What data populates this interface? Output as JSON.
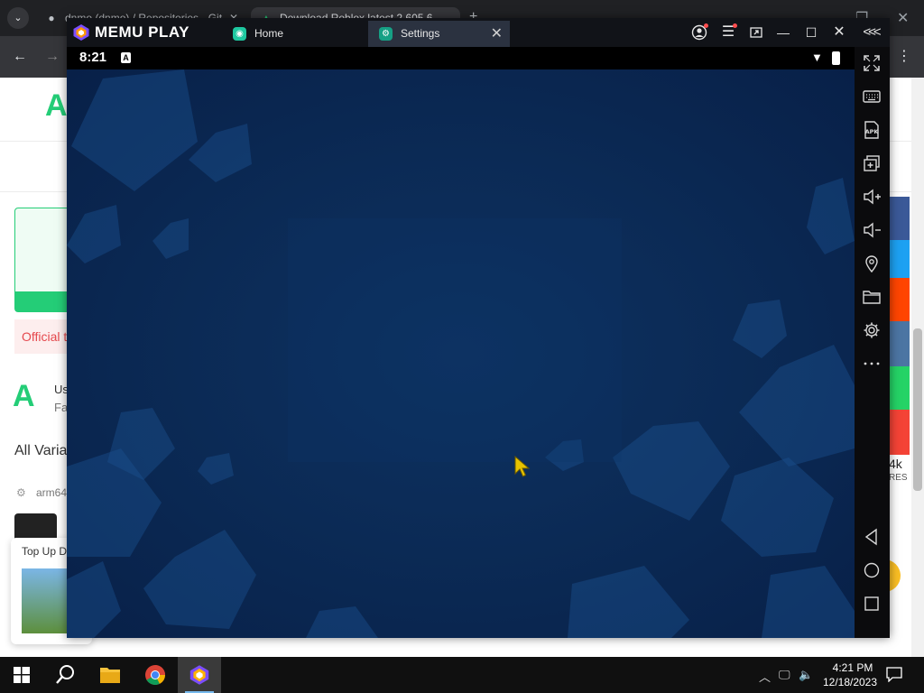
{
  "chrome": {
    "tabs": [
      {
        "label": "dnmo (dnmo) / Repositories · Git",
        "icon": "github-icon"
      },
      {
        "label": "Download Roblox latest 2.605.6",
        "icon": "apkpure-icon"
      }
    ],
    "new_tab": "+"
  },
  "webpage": {
    "official_tip": "Official t",
    "user_text_1": "Us",
    "user_text_2": "Fa",
    "section_title": "All Varia",
    "arch": "arm64",
    "topup_label": "Top Up D",
    "shares_count": "4k",
    "shares_label": "RES"
  },
  "memu": {
    "brand": "MEMU PLAY",
    "tabs": [
      {
        "label": "Home",
        "active": false
      },
      {
        "label": "Settings",
        "active": true
      }
    ],
    "android": {
      "time": "8:21",
      "status_a": "A"
    }
  },
  "taskbar": {
    "time": "4:21 PM",
    "date": "12/18/2023"
  },
  "colors": {
    "memu_accent": "#7c4dff",
    "wallpaper": "#0b2a55",
    "apkpure_green": "#24cd77"
  }
}
